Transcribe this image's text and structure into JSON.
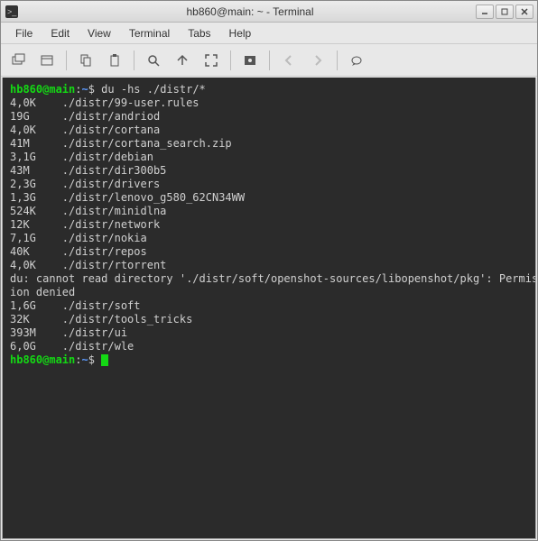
{
  "titlebar": {
    "title": "hb860@main: ~ - Terminal"
  },
  "menubar": {
    "items": [
      "File",
      "Edit",
      "View",
      "Terminal",
      "Tabs",
      "Help"
    ]
  },
  "toolbar": {
    "icons": [
      "new-tab-icon",
      "new-window-icon",
      "copy-icon",
      "paste-icon",
      "find-icon",
      "zoom-icon",
      "fullscreen-icon",
      "settings-icon",
      "prev-icon",
      "next-icon",
      "about-icon"
    ]
  },
  "prompt": {
    "user_host": "hb860@main",
    "colon": ":",
    "path": "~",
    "symbol": "$ "
  },
  "command": "du -hs ./distr/*",
  "output_rows": [
    {
      "size": "4,0K",
      "path": "./distr/99-user.rules"
    },
    {
      "size": "19G",
      "path": "./distr/andriod"
    },
    {
      "size": "4,0K",
      "path": "./distr/cortana"
    },
    {
      "size": "41M",
      "path": "./distr/cortana_search.zip"
    },
    {
      "size": "3,1G",
      "path": "./distr/debian"
    },
    {
      "size": "43M",
      "path": "./distr/dir300b5"
    },
    {
      "size": "2,3G",
      "path": "./distr/drivers"
    },
    {
      "size": "1,3G",
      "path": "./distr/lenovo_g580_62CN34WW"
    },
    {
      "size": "524K",
      "path": "./distr/minidlna"
    },
    {
      "size": "12K",
      "path": "./distr/network"
    },
    {
      "size": "7,1G",
      "path": "./distr/nokia"
    },
    {
      "size": "40K",
      "path": "./distr/repos"
    },
    {
      "size": "4,0K",
      "path": "./distr/rtorrent"
    }
  ],
  "error_line": "du: cannot read directory './distr/soft/openshot-sources/libopenshot/pkg': Permission denied",
  "output_rows2": [
    {
      "size": "1,6G",
      "path": "./distr/soft"
    },
    {
      "size": "32K",
      "path": "./distr/tools_tricks"
    },
    {
      "size": "393M",
      "path": "./distr/ui"
    },
    {
      "size": "6,0G",
      "path": "./distr/wle"
    }
  ]
}
